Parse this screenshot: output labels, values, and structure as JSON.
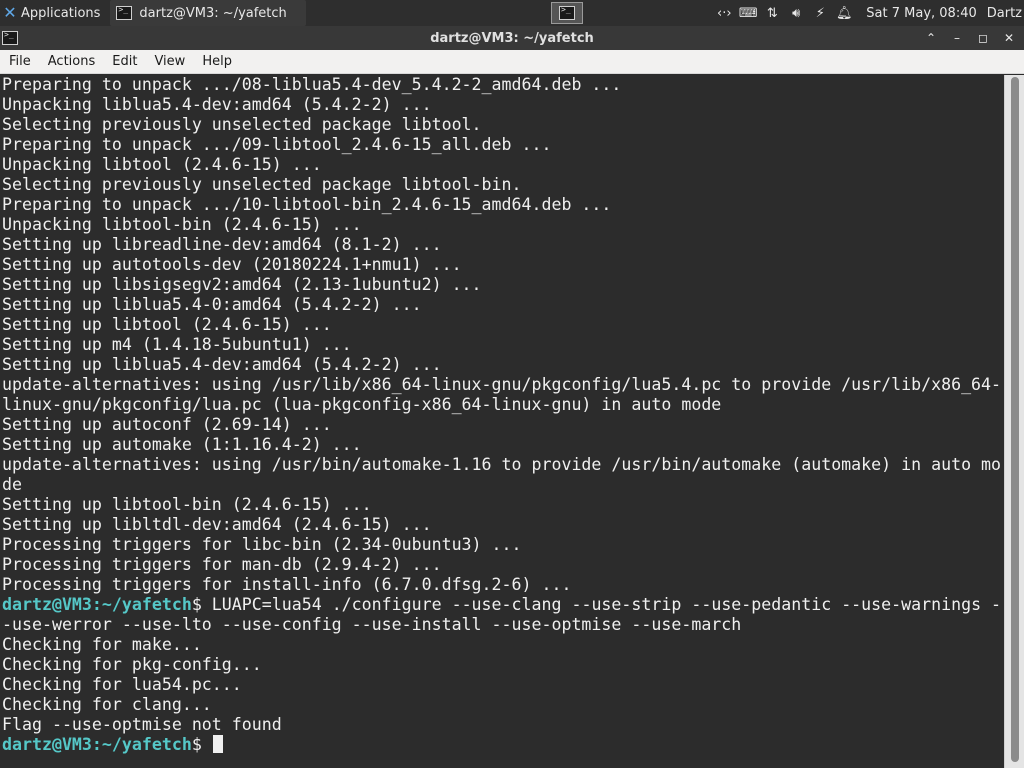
{
  "panel": {
    "apps_label": "Applications",
    "task_label": "dartz@VM3: ~/yafetch",
    "clock": "Sat  7 May, 08:40",
    "user": "Dartz",
    "tray_icons": [
      "code-icon",
      "keyboard-icon",
      "network-icon",
      "volume-icon",
      "power-icon",
      "notification-bell-icon"
    ]
  },
  "window": {
    "title": "dartz@VM3: ~/yafetch"
  },
  "menubar": {
    "items": [
      "File",
      "Actions",
      "Edit",
      "View",
      "Help"
    ]
  },
  "terminal": {
    "prompt_user": "dartz@VM3",
    "prompt_path": "~/yafetch",
    "lines": [
      {
        "text": "Preparing to unpack .../08-liblua5.4-dev_5.4.2-2_amd64.deb ..."
      },
      {
        "text": "Unpacking liblua5.4-dev:amd64 (5.4.2-2) ..."
      },
      {
        "text": "Selecting previously unselected package libtool."
      },
      {
        "text": "Preparing to unpack .../09-libtool_2.4.6-15_all.deb ..."
      },
      {
        "text": "Unpacking libtool (2.4.6-15) ..."
      },
      {
        "text": "Selecting previously unselected package libtool-bin."
      },
      {
        "text": "Preparing to unpack .../10-libtool-bin_2.4.6-15_amd64.deb ..."
      },
      {
        "text": "Unpacking libtool-bin (2.4.6-15) ..."
      },
      {
        "text": "Setting up libreadline-dev:amd64 (8.1-2) ..."
      },
      {
        "text": "Setting up autotools-dev (20180224.1+nmu1) ..."
      },
      {
        "text": "Setting up libsigsegv2:amd64 (2.13-1ubuntu2) ..."
      },
      {
        "text": "Setting up liblua5.4-0:amd64 (5.4.2-2) ..."
      },
      {
        "text": "Setting up libtool (2.4.6-15) ..."
      },
      {
        "text": "Setting up m4 (1.4.18-5ubuntu1) ..."
      },
      {
        "text": "Setting up liblua5.4-dev:amd64 (5.4.2-2) ..."
      },
      {
        "text": "update-alternatives: using /usr/lib/x86_64-linux-gnu/pkgconfig/lua5.4.pc to provide /usr/lib/x86_64-"
      },
      {
        "text": "linux-gnu/pkgconfig/lua.pc (lua-pkgconfig-x86_64-linux-gnu) in auto mode"
      },
      {
        "text": "Setting up autoconf (2.69-14) ..."
      },
      {
        "text": "Setting up automake (1:1.16.4-2) ..."
      },
      {
        "text": "update-alternatives: using /usr/bin/automake-1.16 to provide /usr/bin/automake (automake) in auto mo"
      },
      {
        "text": "de"
      },
      {
        "text": "Setting up libtool-bin (2.4.6-15) ..."
      },
      {
        "text": "Setting up libltdl-dev:amd64 (2.4.6-15) ..."
      },
      {
        "text": "Processing triggers for libc-bin (2.34-0ubuntu3) ..."
      },
      {
        "text": "Processing triggers for man-db (2.9.4-2) ..."
      },
      {
        "text": "Processing triggers for install-info (6.7.0.dfsg.2-6) ..."
      },
      {
        "prompt": true,
        "text": "$ LUAPC=lua54 ./configure --use-clang --use-strip --use-pedantic --use-warnings -"
      },
      {
        "text": "-use-werror --use-lto --use-config --use-install --use-optmise --use-march"
      },
      {
        "text": "Checking for make..."
      },
      {
        "text": "Checking for pkg-config..."
      },
      {
        "text": "Checking for lua54.pc..."
      },
      {
        "text": "Checking for clang..."
      },
      {
        "text": "Flag --use-optmise not found"
      },
      {
        "prompt": true,
        "cursor": true,
        "text": "$ "
      }
    ]
  },
  "colors": {
    "terminal_bg": "#2c2c2c",
    "terminal_fg": "#f0f0f0",
    "prompt": "#55c8c8",
    "panel_bg": "#2e2e2e"
  }
}
